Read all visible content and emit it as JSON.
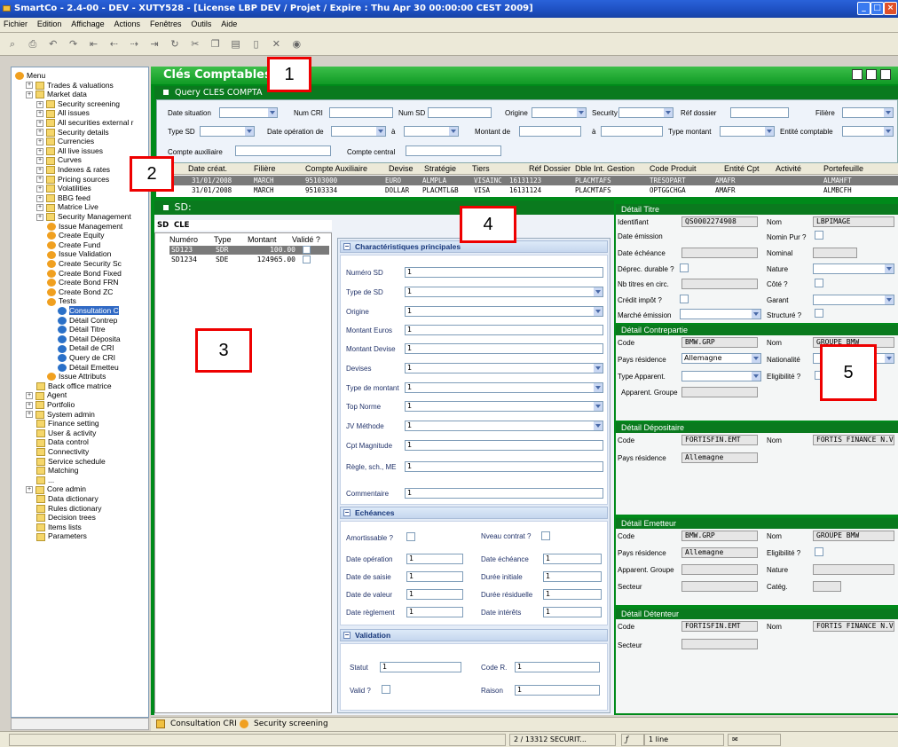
{
  "window": {
    "title": "SmartCo - 2.4-00 - DEV - XUTY528 - [License LBP DEV / Projet / Expire : Thu Apr 30 00:00:00 CEST 2009]"
  },
  "menu": [
    "Fichier",
    "Edition",
    "Affichage",
    "Actions",
    "Fenêtres",
    "Outils",
    "Aide"
  ],
  "tree": [
    {
      "label": "Menu",
      "level": 0
    },
    {
      "label": "Trades & valuations",
      "level": 1
    },
    {
      "label": "Market data",
      "level": 1
    },
    {
      "label": "Security screening",
      "level": 2
    },
    {
      "label": "All issues",
      "level": 2
    },
    {
      "label": "All securities external r",
      "level": 2
    },
    {
      "label": "Security details",
      "level": 2
    },
    {
      "label": "Currencies",
      "level": 2
    },
    {
      "label": "All live issues",
      "level": 2
    },
    {
      "label": "Curves",
      "level": 2
    },
    {
      "label": "Indexes & rates",
      "level": 2
    },
    {
      "label": "Pricing sources",
      "level": 2
    },
    {
      "label": "Volatilities",
      "level": 2
    },
    {
      "label": "BBG feed",
      "level": 2
    },
    {
      "label": "Matrice Live",
      "level": 2
    },
    {
      "label": "Security Management",
      "level": 2
    },
    {
      "label": "Issue Management",
      "level": 3
    },
    {
      "label": "Create Equity",
      "level": 3
    },
    {
      "label": "Create Fund",
      "level": 3
    },
    {
      "label": "Issue Validation",
      "level": 3
    },
    {
      "label": "Create Security Sc",
      "level": 3
    },
    {
      "label": "Create Bond Fixed",
      "level": 3
    },
    {
      "label": "Create Bond FRN",
      "level": 3
    },
    {
      "label": "Create Bond ZC",
      "level": 3
    },
    {
      "label": "Tests",
      "level": 3
    },
    {
      "label": "Consultation C",
      "level": 4
    },
    {
      "label": "Détail Contrep",
      "level": 4
    },
    {
      "label": "Détail Titre",
      "level": 4
    },
    {
      "label": "Détail Déposita",
      "level": 4
    },
    {
      "label": "Detail de CRI",
      "level": 4
    },
    {
      "label": "Query de CRI",
      "level": 4
    },
    {
      "label": "Détail Emetteu",
      "level": 4
    },
    {
      "label": "Issue Attributs",
      "level": 3
    },
    {
      "label": "Back office matrice",
      "level": 2
    },
    {
      "label": "Agent",
      "level": 1
    },
    {
      "label": "Portfolio",
      "level": 1
    },
    {
      "label": "System admin",
      "level": 1
    },
    {
      "label": "Finance setting",
      "level": 2
    },
    {
      "label": "User & activity",
      "level": 2
    },
    {
      "label": "Data control",
      "level": 2
    },
    {
      "label": "Connectivity",
      "level": 2
    },
    {
      "label": "Service schedule",
      "level": 2
    },
    {
      "label": "Matching",
      "level": 2
    },
    {
      "label": "...",
      "level": 2
    },
    {
      "label": "Core admin",
      "level": 1
    },
    {
      "label": "Data dictionary",
      "level": 2
    },
    {
      "label": "Rules dictionary",
      "level": 2
    },
    {
      "label": "Decision trees",
      "level": 2
    },
    {
      "label": "Items lists",
      "level": 2
    },
    {
      "label": "Parameters",
      "level": 2
    }
  ],
  "main": {
    "title": "Clés Comptables",
    "query_title": "Query CLES COMPTA"
  },
  "query": {
    "date_situation": "Date situation",
    "num_cri": "Num CRI",
    "num_sd": "Num SD",
    "origine": "Origine",
    "security": "Security",
    "ref_dossier": "Réf dossier",
    "filiere": "Filière",
    "type_sd": "Type SD",
    "date_operation_de": "Date opération de",
    "a1": "à",
    "montant_de": "Montant de",
    "a2": "à",
    "type_montant": "Type montant",
    "entite": "Entité comptable",
    "compte_auxiliaire": "Compte auxiliaire",
    "compte_central": "Compte central"
  },
  "results": {
    "headers": [
      "Date créat.",
      "Filière",
      "Compte Auxiliaire",
      "Devise",
      "Stratégie",
      "Tiers",
      "Réf Dossier",
      "Dble Int. Gestion",
      "Code Produit",
      "Entité Cpt",
      "Activité",
      "Portefeuille"
    ],
    "rows": [
      [
        "31/01/2008",
        "MARCH",
        "95103000",
        "EURO",
        "ALMPLA",
        "VISAINC",
        "16131123",
        "PLACMTAFS",
        "TRESOPART",
        "AMAFR",
        "",
        "ALMAHFT"
      ],
      [
        "31/01/2008",
        "MARCH",
        "95103334",
        "DOLLAR",
        "PLACMTL&B",
        "VISA",
        "16131124",
        "PLACMTAFS",
        "OPTGGCHGA",
        "AMAFR",
        "",
        "ALMBCFH"
      ]
    ]
  },
  "sd": {
    "title": "SD:",
    "tabs": [
      "SD",
      "CLE"
    ],
    "headers": [
      "Numéro",
      "Type",
      "Montant",
      "Validé ?"
    ],
    "rows": [
      [
        "SD123",
        "SDR",
        "100.00"
      ],
      [
        "SD1234",
        "SDE",
        "124965.00"
      ]
    ]
  },
  "charac": {
    "title": "Charactéristiques principales",
    "fields": [
      {
        "label": "Numéro SD",
        "value": "1"
      },
      {
        "label": "Type de SD",
        "value": "1"
      },
      {
        "label": "Origine",
        "value": "1"
      },
      {
        "label": "Montant Euros",
        "value": "1"
      },
      {
        "label": "Montant Devise",
        "value": "1"
      },
      {
        "label": "Devises",
        "value": "1"
      },
      {
        "label": "Type de montant",
        "value": "1"
      },
      {
        "label": "Top Norme",
        "value": "1"
      },
      {
        "label": "JV Méthode",
        "value": "1"
      },
      {
        "label": "Cpt Magnitude",
        "value": "1"
      },
      {
        "label": "Règle, sch., ME",
        "value": "1"
      },
      {
        "label": "Commentaire",
        "value": "1"
      }
    ],
    "echeances_title": "Echéances",
    "amortissable": "Amortissable ?",
    "nveau_contrat": "Nveau contrat ?",
    "ech_fields": [
      {
        "l1": "Date opération",
        "v1": "1",
        "l2": "Date échéance",
        "v2": "1"
      },
      {
        "l1": "Date de saisie",
        "v1": "1",
        "l2": "Durée initiale",
        "v2": "1"
      },
      {
        "l1": "Date de valeur",
        "v1": "1",
        "l2": "Durée résiduelle",
        "v2": "1"
      },
      {
        "l1": "Date règlement",
        "v1": "1",
        "l2": "Date intérêts",
        "v2": "1"
      }
    ],
    "validation_title": "Validation",
    "statut": "Statut",
    "statut_v": "1",
    "code_r": "Code R.",
    "code_r_v": "1",
    "valid": "Valid ?",
    "raison": "Raison",
    "raison_v": "1"
  },
  "titre": {
    "title": "Détail Titre",
    "identifiant": "Identifiant",
    "identifiant_v": "QS0002274908",
    "nom": "Nom",
    "nom_v": "LBPIMAGE",
    "date_emission": "Date émission",
    "nomin_pur": "Nomin Pur ?",
    "date_echeance": "Date échéance",
    "nominal": "Nominal",
    "deprec": "Déprec. durable ?",
    "nature": "Nature",
    "nb_titres": "Nb titres en circ.",
    "cote": "Côté ?",
    "credit_impot": "Crédit impôt ?",
    "garant": "Garant",
    "marche_emission": "Marché émission",
    "structure": "Structuré ?"
  },
  "contrepartie": {
    "title": "Détail Contrepartie",
    "code": "Code",
    "code_v": "BMW.GRP",
    "nom": "Nom",
    "nom_v": "GROUPE BMW",
    "pays": "Pays résidence",
    "pays_v": "Allemagne",
    "nationalite": "Nationalité",
    "type_apparent": "Type  Apparent.",
    "eligibilite": "Eligibilité ?",
    "apparent_groupe": "Apparent. Groupe"
  },
  "depositaire": {
    "title": "Détail Dépositaire",
    "code": "Code",
    "code_v": "FORTISFIN.EMT",
    "nom": "Nom",
    "nom_v": "FORTIS FINANCE N.V.",
    "pays": "Pays résidence",
    "pays_v": "Allemagne"
  },
  "emetteur": {
    "title": "Détail Emetteur",
    "code": "Code",
    "code_v": "BMW.GRP",
    "nom": "Nom",
    "nom_v": "GROUPE BMW",
    "pays": "Pays résidence",
    "pays_v": "Allemagne",
    "eligibilite": "Eligibilité ?",
    "apparent_groupe": "Apparent. Groupe",
    "nature": "Nature",
    "secteur": "Secteur",
    "categ": "Catég."
  },
  "detenteur": {
    "title": "Détail Détenteur",
    "code": "Code",
    "code_v": "FORTISFIN.EMT",
    "nom": "Nom",
    "nom_v": "FORTIS FINANCE N.V.",
    "secteur": "Secteur"
  },
  "bottom_tabs": [
    "Consultation CRI",
    "Security screening"
  ],
  "status": {
    "position": "2 / 13312 SECURIT...",
    "lines": "1 line"
  },
  "markers": [
    "1",
    "2",
    "3",
    "4",
    "5"
  ]
}
